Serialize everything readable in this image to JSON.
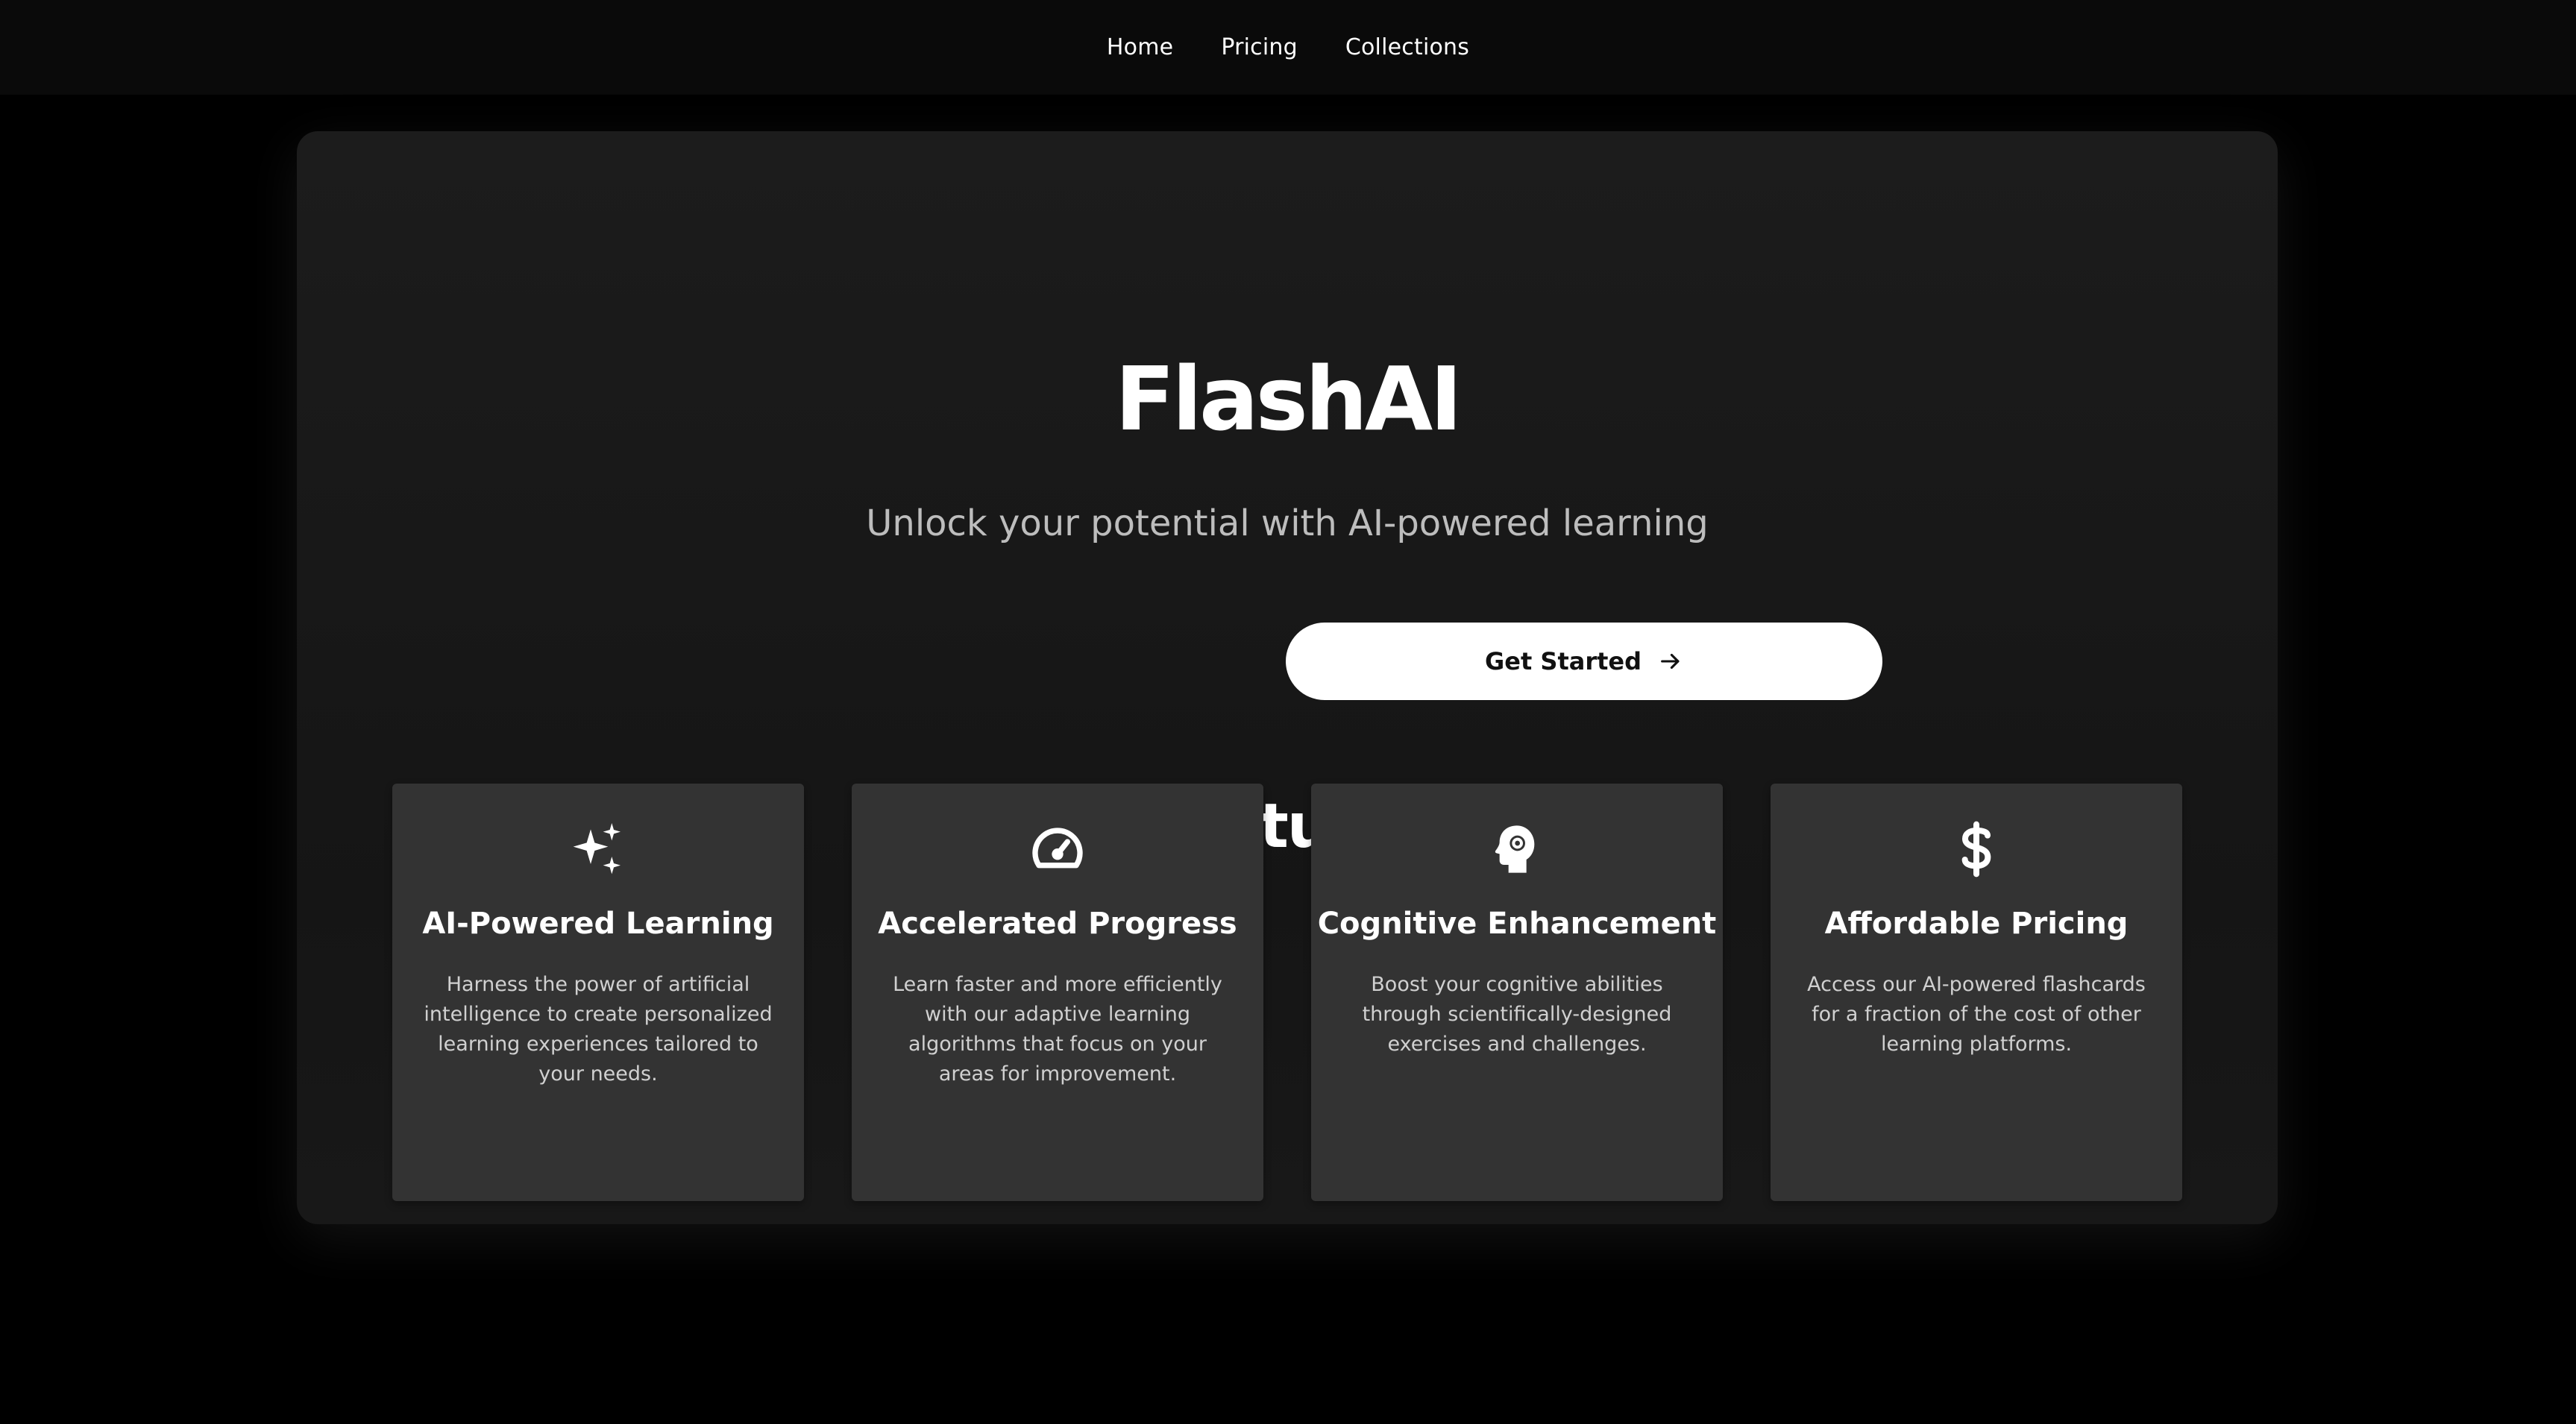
{
  "nav": {
    "items": [
      {
        "label": "Home"
      },
      {
        "label": "Pricing"
      },
      {
        "label": "Collections"
      }
    ]
  },
  "hero": {
    "title": "FlashAI",
    "subtitle": "Unlock your potential with AI-powered learning",
    "cta_label": "Get Started",
    "cta_icon": "arrow-right-icon"
  },
  "features": {
    "title": "Features",
    "items": [
      {
        "icon": "sparkles-icon",
        "title": "AI-Powered Learning",
        "description": "Harness the power of artificial intelligence to create personalized learning experiences tailored to your needs."
      },
      {
        "icon": "speedometer-icon",
        "title": "Accelerated Progress",
        "description": "Learn faster and more efficiently with our adaptive learning algorithms that focus on your areas for improvement."
      },
      {
        "icon": "brain-gear-icon",
        "title": "Cognitive Enhancement",
        "description": "Boost your cognitive abilities through scientifically-designed exercises and challenges."
      },
      {
        "icon": "dollar-sign-icon",
        "title": "Affordable Pricing",
        "description": "Access our AI-powered flashcards for a fraction of the cost of other learning platforms."
      }
    ]
  },
  "colors": {
    "page_background": "#000000",
    "navbar_background": "#0a0a0a",
    "card_background": "#1a1a1a",
    "feature_card_background": "#333333",
    "button_background": "#ffffff",
    "text_primary": "#ffffff",
    "text_secondary": "#bdbdbd"
  }
}
